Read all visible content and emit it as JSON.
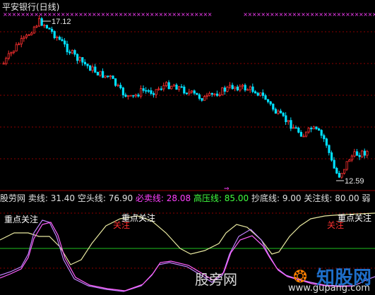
{
  "header": {
    "title": "平安银行(日线)"
  },
  "price_chart": {
    "high_label": "17.12",
    "low_label": "12.59"
  },
  "indicator": {
    "name": "股劳网",
    "items": [
      {
        "label": "卖线:",
        "value": "31.40",
        "color": "#e0e0e0"
      },
      {
        "label": "空头线:",
        "value": "76.90",
        "color": "#e0e0e0"
      },
      {
        "label": "必卖线:",
        "value": "28.08",
        "color": "#ff40ff"
      },
      {
        "label": "高压线:",
        "value": "85.00",
        "color": "#40ff40"
      },
      {
        "label": "抄底线:",
        "value": "9.00",
        "color": "#e0e0e0"
      },
      {
        "label": "关注线:",
        "value": "80.00",
        "color": "#e0e0e0"
      },
      {
        "label": "弱",
        "value": "",
        "color": "#e0e0e0"
      }
    ],
    "annotations": [
      {
        "text": "重点关注",
        "color": "#ffffff"
      },
      {
        "text": "关注",
        "color": "#ff3030"
      },
      {
        "text": "重点关注",
        "color": "#ffffff"
      },
      {
        "text": "关注",
        "color": "#ff3030"
      },
      {
        "text": "重点关注",
        "color": "#ffffff"
      }
    ]
  },
  "watermark": {
    "text1": "股旁网",
    "text2": "www.gupang.com",
    "logo_text": "知股网"
  },
  "colors": {
    "up": "#ff3030",
    "down": "#00e0ff",
    "grid": "#8b0000",
    "cross": "#ff40ff",
    "green_line": "#20c020",
    "white_line": "#e8e8a0",
    "purple_line": "#c080ff",
    "pink_line": "#ff60ff"
  }
}
